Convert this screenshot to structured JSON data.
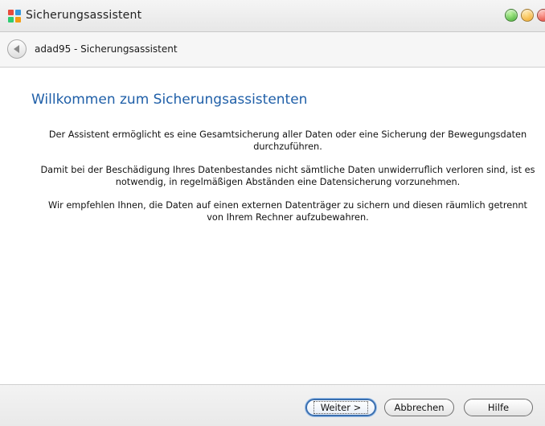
{
  "window": {
    "title": "Sicherungsassistent"
  },
  "nav": {
    "title": "adad95 - Sicherungsassistent"
  },
  "content": {
    "heading": "Willkommen zum Sicherungsassistenten",
    "paragraphs": [
      "Der Assistent ermöglicht es eine Gesamtsicherung aller Daten oder eine Sicherung der Bewegungsdaten durchzuführen.",
      "Damit bei der Beschädigung Ihres Datenbestandes nicht sämtliche Daten unwiderruflich verloren sind, ist es notwendig,  in regelmäßigen Abständen eine Datensicherung vorzunehmen.",
      "Wir empfehlen Ihnen, die Daten auf einen externen Datenträger zu sichern und diesen räumlich getrennt von Ihrem Rechner aufzubewahren."
    ]
  },
  "buttons": {
    "next": "Weiter >",
    "cancel": "Abbrechen",
    "help": "Hilfe"
  },
  "icons": {
    "app": "app-icon",
    "back": "back-arrow-icon",
    "minimize": "minimize-icon",
    "maximize": "maximize-icon",
    "close": "close-icon"
  },
  "colors": {
    "heading": "#1f5fa8",
    "primary_border": "#3a6fb0"
  }
}
